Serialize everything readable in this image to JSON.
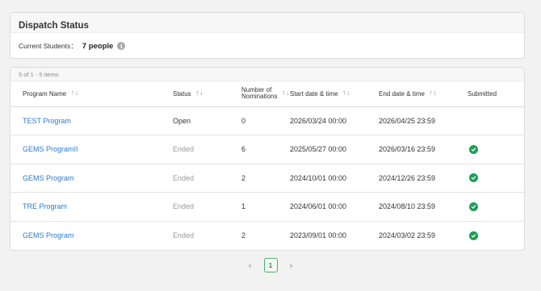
{
  "dispatch": {
    "title": "Dispatch Status",
    "current_label": "Current Students：",
    "current_value": "7 people",
    "info_glyph": "i"
  },
  "table": {
    "count_text": "5 of 1 - 5 items",
    "headers": {
      "program_name": "Program Name",
      "status": "Status",
      "nominations_line1": "Number of",
      "nominations_line2": "Nominations",
      "start": "Start date & time",
      "end": "End date & time",
      "submitted": "Submitted"
    },
    "rows": [
      {
        "program": "TEST Program",
        "status": "Open",
        "nominations": "0",
        "start": "2026/03/24 00:00",
        "end": "2026/04/25 23:59",
        "submitted": false
      },
      {
        "program": "GEMS ProgramII",
        "status": "Ended",
        "nominations": "6",
        "start": "2025/05/27 00:00",
        "end": "2026/03/16 23:59",
        "submitted": true
      },
      {
        "program": "GEMS Program",
        "status": "Ended",
        "nominations": "2",
        "start": "2024/10/01 00:00",
        "end": "2024/12/26 23:59",
        "submitted": true
      },
      {
        "program": "TRE Program",
        "status": "Ended",
        "nominations": "1",
        "start": "2024/06/01 00:00",
        "end": "2024/08/10 23:59",
        "submitted": true
      },
      {
        "program": "GEMS Program",
        "status": "Ended",
        "nominations": "2",
        "start": "2023/09/01 00:00",
        "end": "2024/03/02 23:59",
        "submitted": true
      }
    ]
  },
  "pagination": {
    "prev_glyph": "‹",
    "next_glyph": "›",
    "current_page": "1"
  },
  "colors": {
    "link": "#2a7bd1",
    "submitted_check": "#1f9d55",
    "active_page_border": "#4caf6b"
  }
}
